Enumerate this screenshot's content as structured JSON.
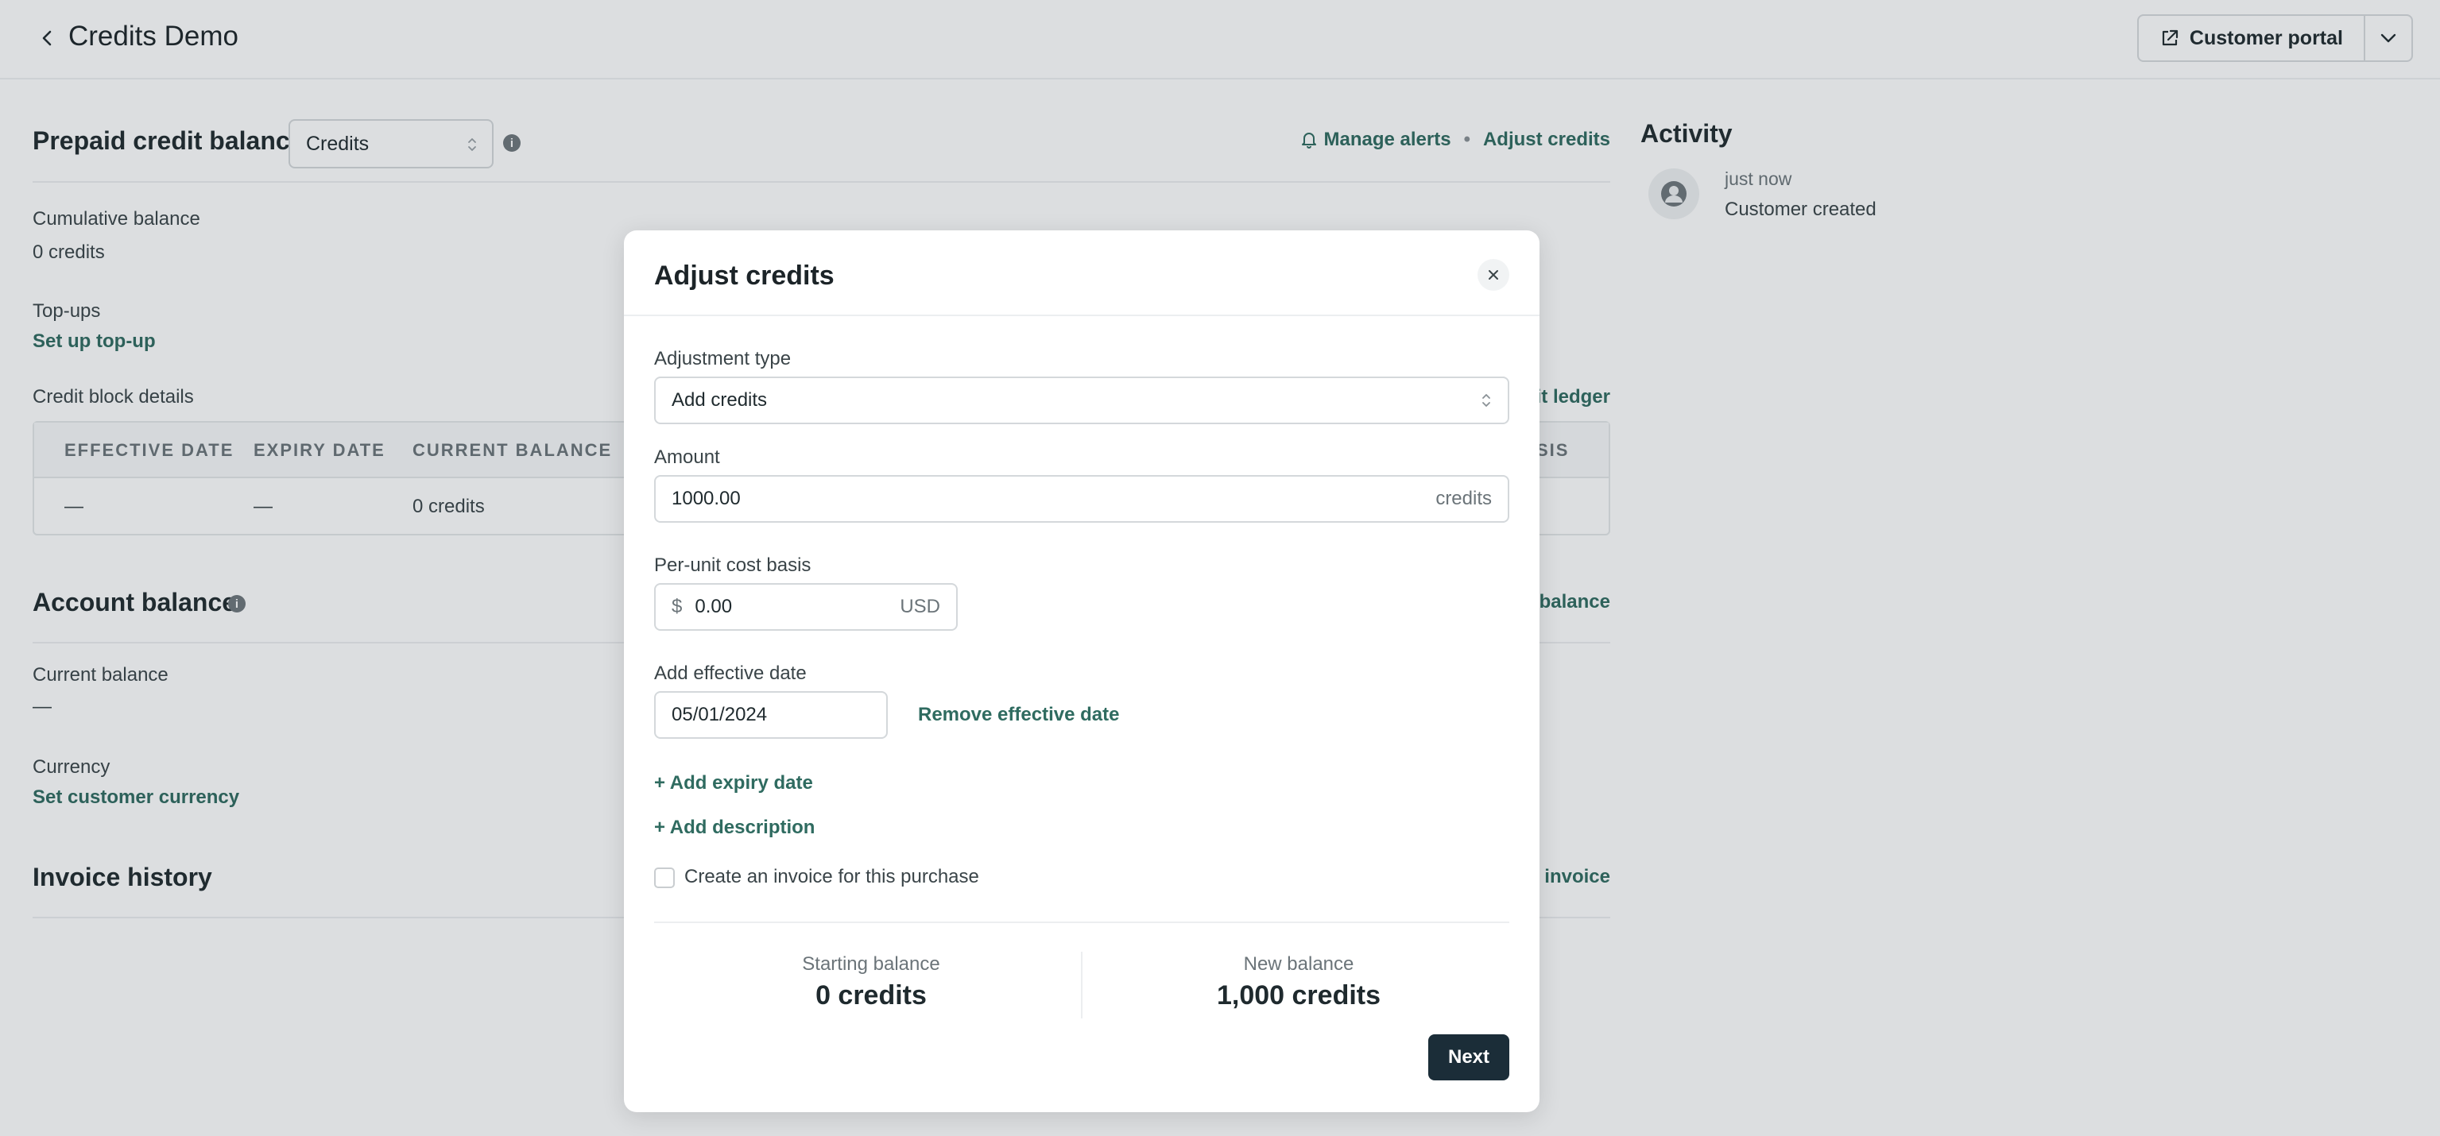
{
  "header": {
    "title": "Credits Demo",
    "portal_label": "Customer portal"
  },
  "prepaid": {
    "title": "Prepaid credit balance",
    "select_value": "Credits",
    "manage_alerts": "Manage alerts",
    "separator": "•",
    "adjust_credits": "Adjust credits",
    "cumulative_label": "Cumulative balance",
    "cumulative_value": "0 credits",
    "topups_label": "Top-ups",
    "topups_link": "Set up top-up",
    "block_details_label": "Credit block details",
    "ledger_link_partial": "it ledger",
    "columns": [
      "EFFECTIVE DATE",
      "EXPIRY DATE",
      "CURRENT BALANCE",
      "SIS"
    ],
    "row": [
      "—",
      "—",
      "0 credits"
    ]
  },
  "account": {
    "title": "Account balance",
    "balance_link_partial": "balance",
    "current_label": "Current balance",
    "current_value": "—",
    "currency_label": "Currency",
    "currency_link": "Set customer currency"
  },
  "invoices": {
    "title": "Invoice history",
    "new_invoice_partial": "v invoice"
  },
  "activity": {
    "title": "Activity",
    "time": "just now",
    "text": "Customer created"
  },
  "modal": {
    "title": "Adjust credits",
    "adjustment_type_label": "Adjustment type",
    "adjustment_type_value": "Add credits",
    "amount_label": "Amount",
    "amount_value": "1000.00",
    "amount_suffix": "credits",
    "cost_basis_label": "Per-unit cost basis",
    "cost_prefix": "$",
    "cost_value": "0.00",
    "cost_suffix": "USD",
    "effective_date_label": "Add effective date",
    "effective_date_value": "05/01/2024",
    "remove_effective_date": "Remove effective date",
    "add_expiry": "+ Add expiry date",
    "add_description": "+ Add description",
    "invoice_checkbox_label": "Create an invoice for this purchase",
    "invoice_checked": false,
    "starting_balance_label": "Starting balance",
    "starting_balance_value": "0 credits",
    "new_balance_label": "New balance",
    "new_balance_value": "1,000 credits",
    "next_label": "Next"
  },
  "colors": {
    "accent_link": "#2f6b60",
    "primary_button": "#1b2d38",
    "overlay": "rgba(39,50,64,0.16)"
  }
}
